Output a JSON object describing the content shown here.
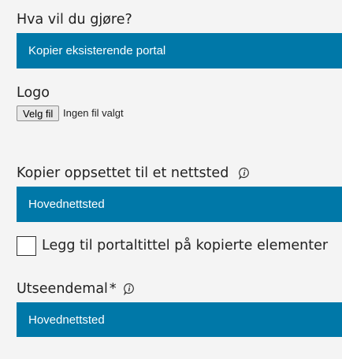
{
  "action": {
    "label": "Hva vil du gjøre?",
    "selected": "Kopier eksisterende portal"
  },
  "logo": {
    "label": "Logo",
    "button_label": "Velg fil",
    "status": "Ingen fil valgt"
  },
  "copy_to_site": {
    "label": "Kopier oppsettet til et nettsted",
    "icon": "info-icon",
    "selected": "Hovednettsted"
  },
  "add_title": {
    "label": "Legg til portaltittel på kopierte elementer",
    "checked": false
  },
  "theme": {
    "label": "Utseendemal",
    "required_mark": "*",
    "icon": "info-icon",
    "selected": "Hovednettsted"
  },
  "colors": {
    "accent": "#0078a8",
    "background": "#f4f4f4"
  }
}
